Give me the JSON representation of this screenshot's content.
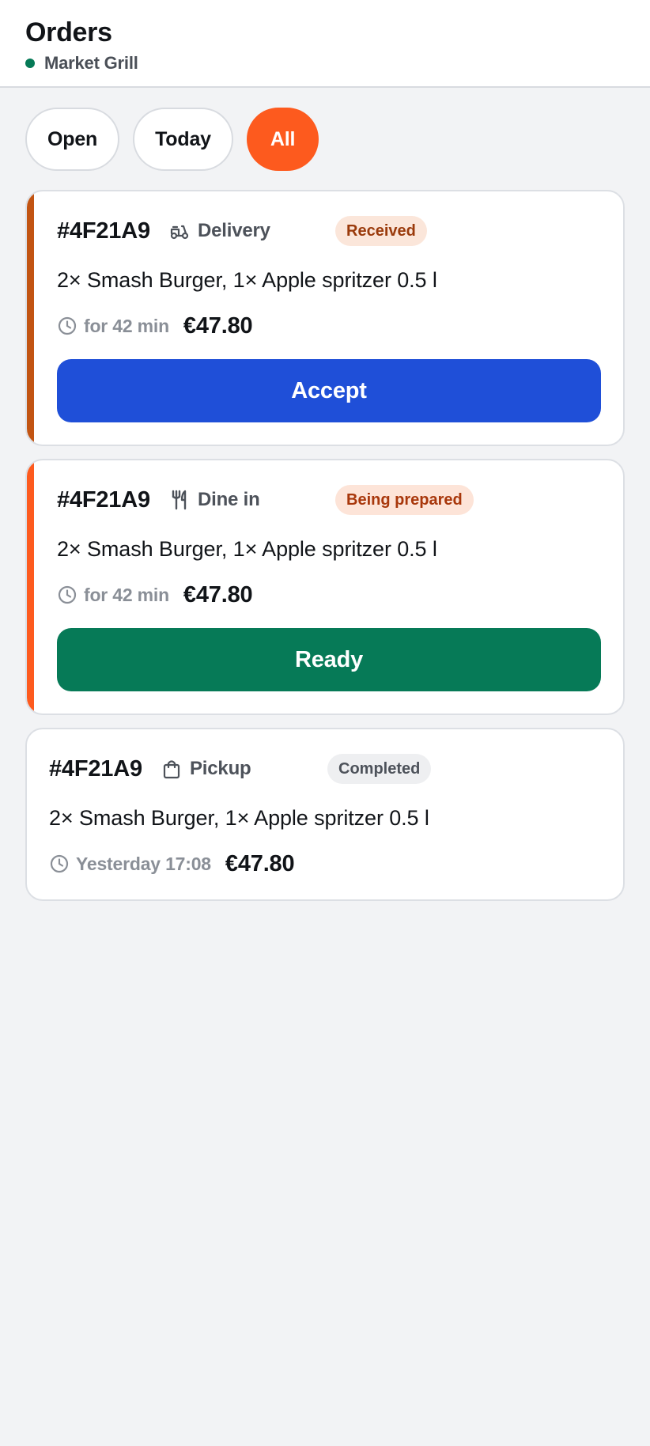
{
  "header": {
    "title": "Orders",
    "restaurant": "Market Grill"
  },
  "filters": [
    {
      "label": "Open",
      "active": false
    },
    {
      "label": "Today",
      "active": false
    },
    {
      "label": "All",
      "active": true
    }
  ],
  "orders": [
    {
      "id": "#4F21A9",
      "type": "Delivery",
      "type_icon": "scooter-icon",
      "status": "Received",
      "items": "2× Smash Burger, 1× Apple spritzer 0.5 l",
      "time": "for 42 min",
      "total": "€47.80",
      "action": "Accept",
      "stripe_color": "#c25412",
      "badge_bg": "#fbe6da",
      "badge_fg": "#9a3a0b",
      "action_color": "#1f4fd8"
    },
    {
      "id": "#4F21A9",
      "type": "Dine in",
      "type_icon": "fork-knife-icon",
      "status": "Being prepared",
      "items": "2× Smash Burger, 1× Apple spritzer 0.5 l",
      "time": "for 42 min",
      "total": "€47.80",
      "action": "Ready",
      "stripe_color": "#fd5a1e",
      "badge_bg": "#fde4d8",
      "badge_fg": "#a8370b",
      "action_color": "#067a57"
    },
    {
      "id": "#4F21A9",
      "type": "Pickup",
      "type_icon": "shopping-bag-icon",
      "status": "Completed",
      "items": "2× Smash Burger, 1× Apple spritzer 0.5 l",
      "time": "Yesterday 17:08",
      "total": "€47.80",
      "badge_bg": "#eeeff1",
      "badge_fg": "#4d525a"
    }
  ],
  "colors": {
    "accent": "#fd5a1e",
    "online": "#067a57",
    "muted": "#8a8f97"
  }
}
